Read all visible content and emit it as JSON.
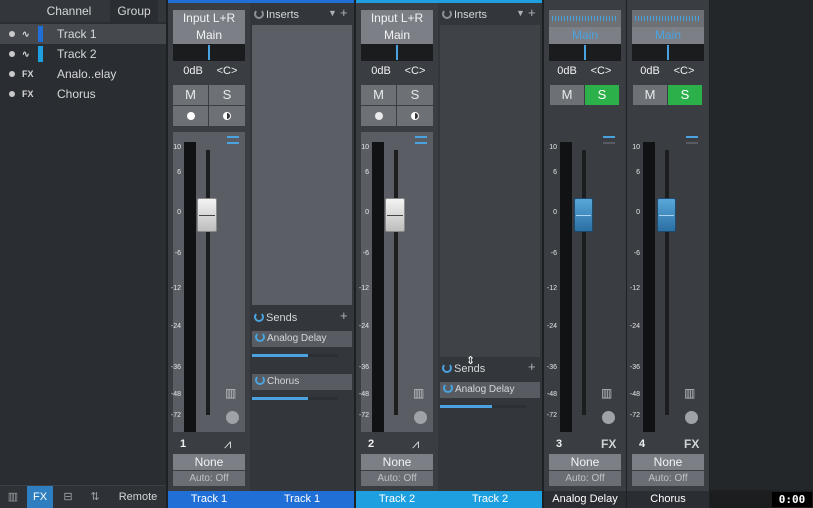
{
  "left_panel": {
    "tabs": [
      "Channel",
      "Group"
    ],
    "rows": [
      {
        "icon": "~",
        "label": "Track 1",
        "color": "#1f6fd6",
        "selected": true
      },
      {
        "icon": "~",
        "label": "Track 2",
        "color": "#1ea0e0",
        "selected": false
      },
      {
        "icon": "FX",
        "label": "Analo..elay",
        "color": "",
        "selected": false
      },
      {
        "icon": "FX",
        "label": "Chorus",
        "color": "",
        "selected": false
      }
    ],
    "bottom": {
      "fx_label": "FX",
      "remote_label": "Remote"
    }
  },
  "scale": [
    "10",
    "6",
    "0",
    "-6",
    "-12",
    "-24",
    "-36",
    "-48",
    "-72"
  ],
  "strips": [
    {
      "input": "Input L+R",
      "output": "Main",
      "db": "0dB",
      "pan": "<C>",
      "mute": "M",
      "solo": "S",
      "number": "1",
      "automation": "None",
      "auto_mode": "Auto: Off",
      "name": "Track 1",
      "name_color": "#1f6fd6"
    },
    {
      "input": "Input L+R",
      "output": "Main",
      "db": "0dB",
      "pan": "<C>",
      "mute": "M",
      "solo": "S",
      "number": "2",
      "automation": "None",
      "auto_mode": "Auto: Off",
      "name": "Track 2",
      "name_color": "#1ea0e0"
    },
    {
      "input": "",
      "output": "Main",
      "db": "0dB",
      "pan": "<C>",
      "mute": "M",
      "solo": "S",
      "number": "3",
      "type": "FX",
      "automation": "None",
      "auto_mode": "Auto: Off",
      "name": "Analog Delay",
      "name_color": "#2a2d31"
    },
    {
      "input": "",
      "output": "Main",
      "db": "0dB",
      "pan": "<C>",
      "mute": "M",
      "solo": "S",
      "number": "4",
      "type": "FX",
      "automation": "None",
      "auto_mode": "Auto: Off",
      "name": "Chorus",
      "name_color": "#2a2d31"
    }
  ],
  "inserts": {
    "label": "Inserts",
    "sends_label": "Sends"
  },
  "track1_sends": [
    {
      "name": "Analog Delay",
      "level": 0.65
    },
    {
      "name": "Chorus",
      "level": 0.65
    }
  ],
  "track2_sends": [
    {
      "name": "Analog Delay",
      "level": 0.6
    }
  ],
  "clock": "0:00"
}
